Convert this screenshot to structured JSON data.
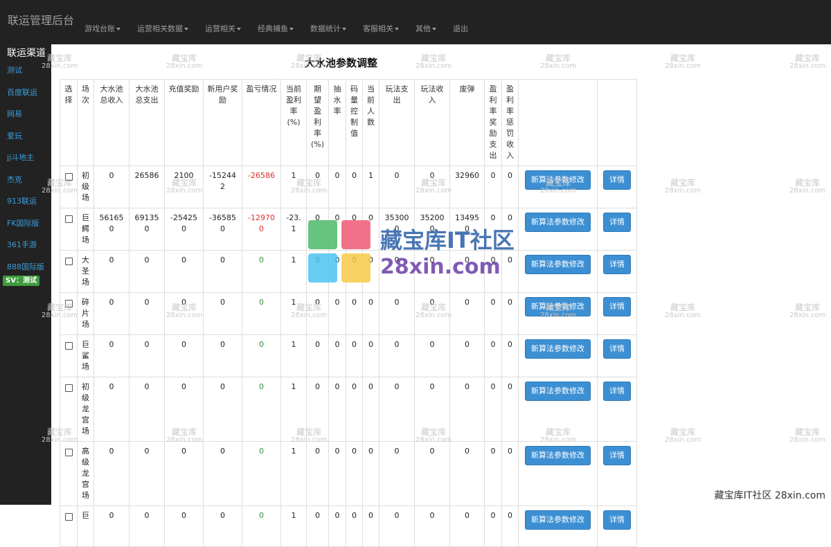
{
  "navbar": {
    "brand": "联运管理后台",
    "items": [
      {
        "label": "游戏台账",
        "dropdown": true
      },
      {
        "label": "运营相关数据",
        "dropdown": true
      },
      {
        "label": "运营相关",
        "dropdown": true
      },
      {
        "label": "经典捕鱼",
        "dropdown": true
      },
      {
        "label": "数据统计",
        "dropdown": true
      },
      {
        "label": "客服相关",
        "dropdown": true
      },
      {
        "label": "其他",
        "dropdown": true
      },
      {
        "label": "退出",
        "dropdown": false
      }
    ]
  },
  "sidebar": {
    "title": "联运渠道",
    "items": [
      "测试",
      "百度联运",
      "网易",
      "爱玩",
      "jj斗地主",
      "杰克",
      "913联运",
      "FK国际版",
      "361手游",
      "888国际版"
    ],
    "badge": "SV：测试"
  },
  "main": {
    "title": "大水池参数调整",
    "columns": [
      "选择",
      "场次",
      "大水池总收入",
      "大水池总支出",
      "充值奖励",
      "新用户奖励",
      "盈亏情况",
      "当前盈利率(%)",
      "期望盈利率(%)",
      "抽水率",
      "码量控制值",
      "当前人数",
      "玩法支出",
      "玩法收入",
      "废弹",
      "盈利率奖励支出",
      "盈利率惩罚收入",
      "",
      ""
    ],
    "edit_button": "新算法参数修改",
    "detail_button": "详情",
    "rows": [
      {
        "name": "初级场",
        "cells": [
          "0",
          "26586",
          "2100",
          "-152442",
          "-26586",
          "1",
          "0",
          "0",
          "0",
          "1",
          "0",
          "0",
          "32960",
          "0",
          "0"
        ],
        "profit_color": "red"
      },
      {
        "name": "巨鳄场",
        "cells": [
          "561650",
          "691350",
          "-254250",
          "-365850",
          "-129700",
          "-23.1",
          "0",
          "0",
          "0",
          "0",
          "353000",
          "352000",
          "134950",
          "0",
          "0"
        ],
        "profit_color": "red"
      },
      {
        "name": "大圣场",
        "cells": [
          "0",
          "0",
          "0",
          "0",
          "0",
          "1",
          "0",
          "0",
          "0",
          "0",
          "0",
          "0",
          "0",
          "0",
          "0"
        ],
        "profit_color": "green"
      },
      {
        "name": "碎片场",
        "cells": [
          "0",
          "0",
          "0",
          "0",
          "0",
          "1",
          "0",
          "0",
          "0",
          "0",
          "0",
          "0",
          "0",
          "0",
          "0"
        ],
        "profit_color": "green"
      },
      {
        "name": "巨鲨场",
        "cells": [
          "0",
          "0",
          "0",
          "0",
          "0",
          "1",
          "0",
          "0",
          "0",
          "0",
          "0",
          "0",
          "0",
          "0",
          "0"
        ],
        "profit_color": "green"
      },
      {
        "name": "初级龙宫场",
        "cells": [
          "0",
          "0",
          "0",
          "0",
          "0",
          "1",
          "0",
          "0",
          "0",
          "0",
          "0",
          "0",
          "0",
          "0",
          "0"
        ],
        "profit_color": "green"
      },
      {
        "name": "高级龙宫场",
        "cells": [
          "0",
          "0",
          "0",
          "0",
          "0",
          "1",
          "0",
          "0",
          "0",
          "0",
          "0",
          "0",
          "0",
          "0",
          "0"
        ],
        "profit_color": "green"
      },
      {
        "name": "巨",
        "cells": [
          "0",
          "0",
          "0",
          "0",
          "0",
          "1",
          "0",
          "0",
          "0",
          "0",
          "0",
          "0",
          "0",
          "0",
          "0"
        ],
        "profit_color": "green"
      }
    ]
  },
  "watermark": {
    "line1": "藏宝库",
    "line2": "28xin.com",
    "logo_line1": "藏宝库IT社区",
    "logo_line2": "28xin.com",
    "corner": "藏宝库IT社区 28xin.com"
  }
}
